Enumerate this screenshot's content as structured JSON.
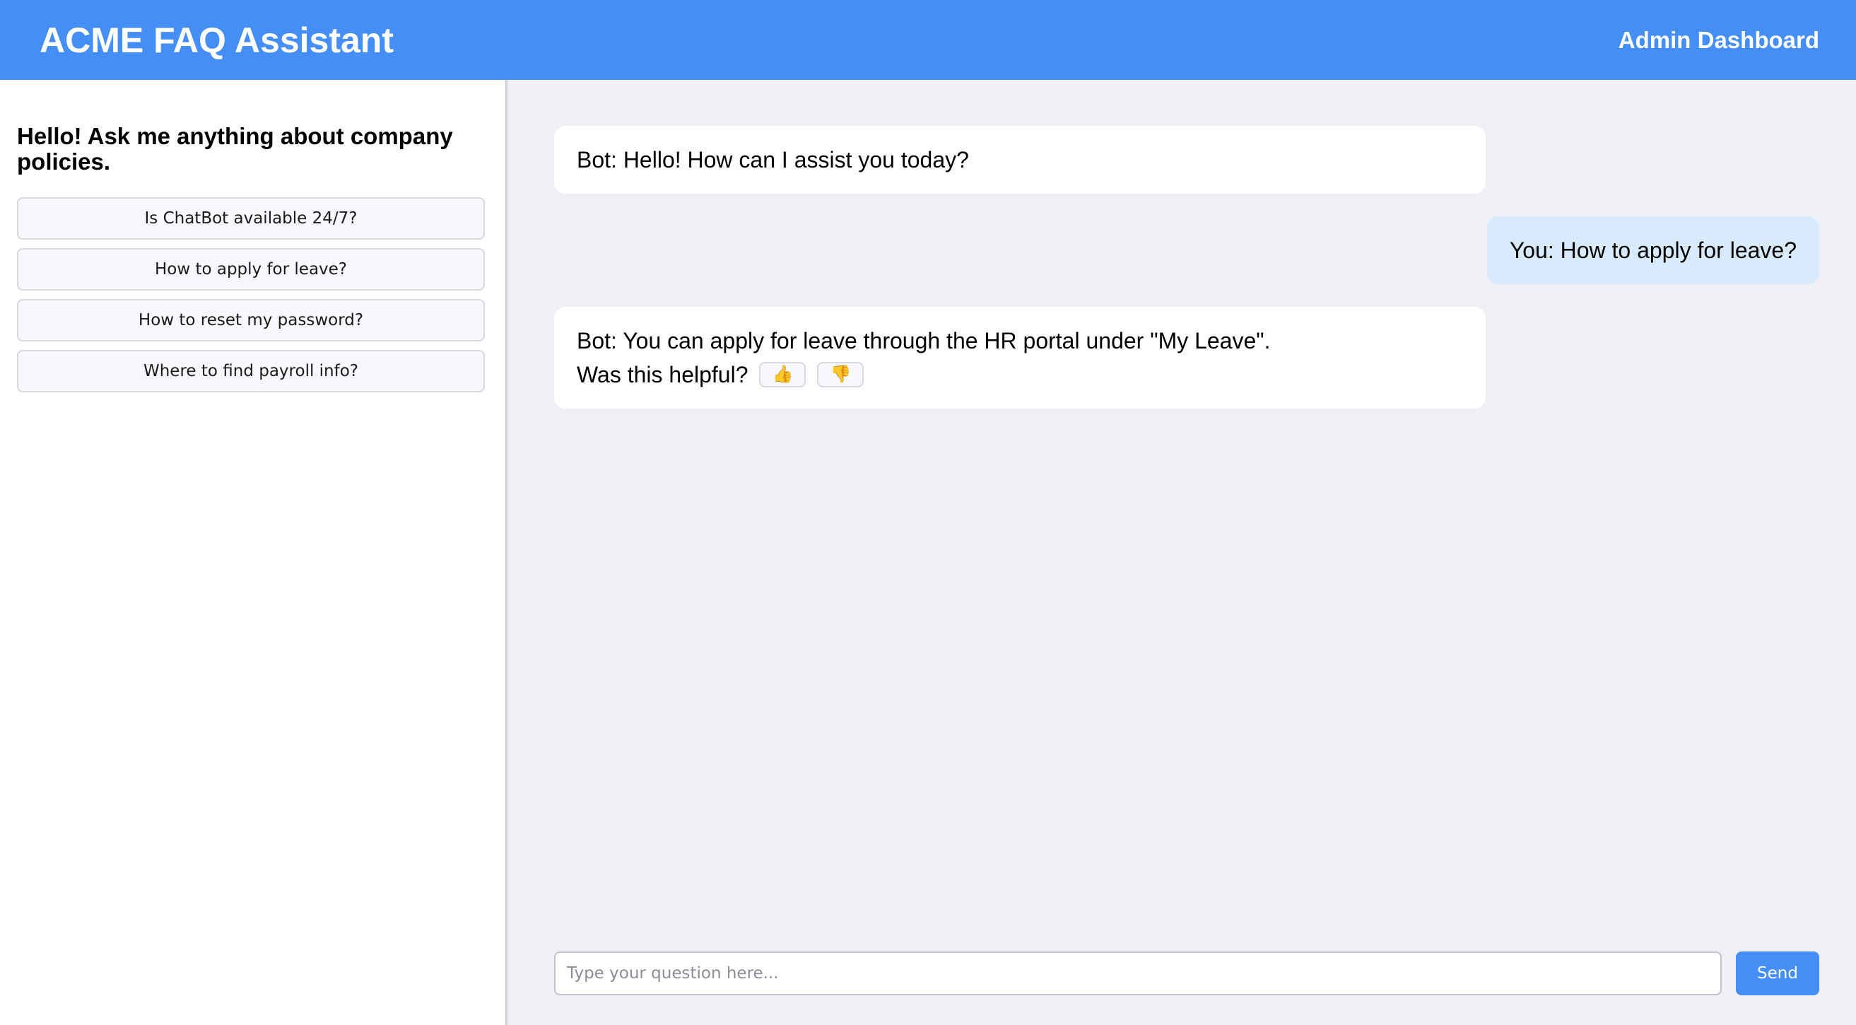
{
  "header": {
    "title": "ACME FAQ Assistant",
    "admin_link": "Admin Dashboard"
  },
  "sidebar": {
    "greeting": "Hello! Ask me anything about company policies.",
    "faqs": [
      "Is ChatBot available 24/7?",
      "How to apply for leave?",
      "How to reset my password?",
      "Where to find payroll info?"
    ]
  },
  "chat": {
    "messages": [
      {
        "sender": "bot",
        "text": "Bot: Hello! How can I assist you today?"
      },
      {
        "sender": "user",
        "text": "You: How to apply for leave?"
      },
      {
        "sender": "bot",
        "text": "Bot: You can apply for leave through the HR portal under \"My Leave\"."
      }
    ],
    "feedback_prompt": "Was this helpful?",
    "thumbs_up": "👍",
    "thumbs_down": "👎"
  },
  "input": {
    "placeholder": "Type your question here...",
    "value": "",
    "send_label": "Send"
  },
  "colors": {
    "header_bg": "#458ef6",
    "chat_bg": "#eff0f6",
    "user_bubble": "#d8ebfc",
    "send_button": "#458ef6"
  }
}
